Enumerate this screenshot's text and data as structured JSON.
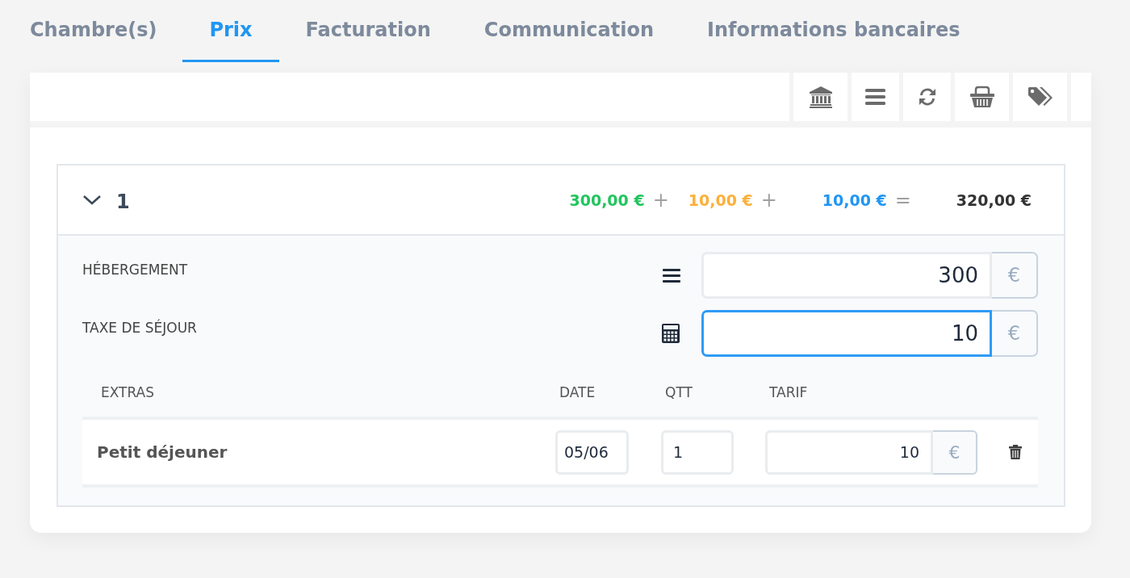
{
  "tabs": [
    {
      "label": "Chambre(s)",
      "selected": false
    },
    {
      "label": "Prix",
      "selected": true
    },
    {
      "label": "Facturation",
      "selected": false
    },
    {
      "label": "Communication",
      "selected": false
    },
    {
      "label": "Informations bancaires",
      "selected": false
    }
  ],
  "group": {
    "number": "1",
    "expanded": true,
    "amounts": [
      {
        "value": "300,00 €",
        "color": "#22c55e",
        "operator": "+"
      },
      {
        "value": "10,00 €",
        "color": "#fbb03b",
        "operator": "+"
      },
      {
        "value": "10,00 €",
        "color": "#2196f3",
        "operator": "="
      }
    ],
    "total": "320,00 €",
    "lines": [
      {
        "label": "HÉBERGEMENT",
        "kind": "list",
        "value": "300",
        "unit": "€",
        "focused": false
      },
      {
        "label": "TAXE DE SÉJOUR",
        "kind": "calculator",
        "value": "10",
        "unit": "€",
        "focused": true
      }
    ],
    "extras": {
      "columns": [
        "EXTRAS",
        "DATE",
        "QTT",
        "TARIF"
      ],
      "rows": [
        {
          "name": "Petit déjeuner",
          "date": "05/06",
          "quantity": "1",
          "rate": "10",
          "unit": "€"
        }
      ]
    }
  }
}
